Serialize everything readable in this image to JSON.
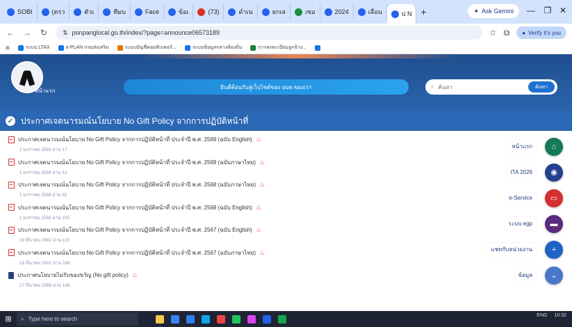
{
  "browser": {
    "tabs": [
      {
        "label": "SOBI",
        "color": "#2563eb"
      },
      {
        "label": "(ตรว",
        "color": "#2563eb"
      },
      {
        "label": "ตัวเ",
        "color": "#2563eb"
      },
      {
        "label": "ทีมบ",
        "color": "#2563eb"
      },
      {
        "label": "Face",
        "color": "#2563eb"
      },
      {
        "label": "ข้อเ",
        "color": "#2563eb"
      },
      {
        "label": "(73)",
        "color": "#d93025"
      },
      {
        "label": "ดำเน",
        "color": "#2563eb"
      },
      {
        "label": "ยกเล",
        "color": "#2563eb"
      },
      {
        "label": "เซอ",
        "color": "#1a8f3c"
      },
      {
        "label": "2024",
        "color": "#2563eb"
      },
      {
        "label": "เลื่อน",
        "color": "#2563eb"
      },
      {
        "label": "ป N",
        "color": "#2563eb"
      }
    ],
    "new_tab": "+",
    "gemini_label": "Ask Gemini",
    "url": "ponpanglocal.go.th/index/?page=announce06573189",
    "profile_label": "Verify it's you",
    "bookmarks": [
      {
        "label": "ระบบ LTAX",
        "color": "#1a73e8"
      },
      {
        "label": "e-PLAN กรมส่งเสริม",
        "color": "#1a73e8"
      },
      {
        "label": "ระบบบัญชีคอมพิวเตอร์...",
        "color": "#e8710a"
      },
      {
        "label": "ระบบข้อมูลกลางท้องถิ่น",
        "color": "#1a73e8"
      },
      {
        "label": "การลงทะเบียนลูกจ้าง...",
        "color": "#188038"
      },
      {
        "label": "",
        "color": "#1a73e8"
      }
    ]
  },
  "site": {
    "logo_text": "หน้าแรก",
    "hero_text": "ยินดีต้อนรับสู่เว็บไซต์ของ อบต.ของเรา",
    "search_placeholder": "ค้นหา",
    "search_button": "ค้นหา"
  },
  "page_title": "ประกาศเจตนารมณ์นโยบาย No Gift Policy จากการปฏิบัติหน้าที่",
  "items": [
    {
      "title": "ประกาศเจตนารมณ์นโยบาย No Gift Policy จากการปฏิบัติหน้าที่ ประจำปี พ.ศ. 2569 (ฉบับ English)",
      "meta": "1 มกราคม 2569 อ่าน 17",
      "icon": "pdf"
    },
    {
      "title": "ประกาศเจตนารมณ์นโยบาย No Gift Policy จากการปฏิบัติหน้าที่ ประจำปี พ.ศ. 2569 (ฉบับภาษาไทย)",
      "meta": "1 มกราคม 2569 อ่าน 42",
      "icon": "pdf"
    },
    {
      "title": "ประกาศเจตนารมณ์นโยบาย No Gift Policy จากการปฏิบัติหน้าที่ ประจำปี พ.ศ. 2568 (ฉบับภาษาไทย)",
      "meta": "1 มกราคม 2568 อ่าน 92",
      "icon": "pdf"
    },
    {
      "title": "ประกาศเจตนารมณ์นโยบาย No Gift Policy จากการปฏิบัติหน้าที่ ประจำปี พ.ศ. 2568 (ฉบับ English)",
      "meta": "1 มกราคม 2568 อ่าน 105",
      "icon": "pdf"
    },
    {
      "title": "ประกาศเจตนารมณ์นโยบาย No Gift Policy จากการปฏิบัติหน้าที่ ประจำปี พ.ศ. 2567 (ฉบับ English)",
      "meta": "19 มีนาคม 2567 อ่าน 115",
      "icon": "pdf"
    },
    {
      "title": "ประกาศเจตนารมณ์นโยบาย No Gift Policy จากการปฏิบัติหน้าที่ ประจำปี พ.ศ. 2567 (ฉบับภาษาไทย)",
      "meta": "19 มีนาคม 2567 อ่าน 288",
      "icon": "pdf"
    },
    {
      "title": "ประกาศนโยบายไม่รับของขวัญ (No gift policy)",
      "meta": "27 มีนาคม 2566 อ่าน 168",
      "icon": "doc"
    }
  ],
  "side_menu": [
    {
      "label": "หน้าแรก",
      "icon": "home-icon",
      "glyph": "⌂",
      "color": "#137a55"
    },
    {
      "label": "ITA 2026",
      "icon": "compass-icon",
      "glyph": "◉",
      "color": "#24408e"
    },
    {
      "label": "e-Service",
      "icon": "monitor-icon",
      "glyph": "▭",
      "color": "#d32f2f"
    },
    {
      "label": "ระบบ egp",
      "icon": "chat-icon",
      "glyph": "▬",
      "color": "#5a2a7e"
    },
    {
      "label": "แชทกับหน่วยงาน",
      "icon": "plus-icon",
      "glyph": "+",
      "color": "#1e63c6"
    },
    {
      "label": "ข้อมูล",
      "icon": "chevron-down-icon",
      "glyph": "⌄",
      "color": "#4a78c8"
    }
  ],
  "taskbar": {
    "search_placeholder": "Type here to search",
    "apps": [
      {
        "color": "#f2c94c"
      },
      {
        "color": "#3b82f6"
      },
      {
        "color": "#2f80ed"
      },
      {
        "color": "#0ea5e9"
      },
      {
        "color": "#ef4444"
      },
      {
        "color": "#22c55e"
      },
      {
        "color": "#d946ef"
      },
      {
        "color": "#2563eb"
      },
      {
        "color": "#16a34a"
      }
    ],
    "tray_text": "ENG",
    "clock": "10:32"
  }
}
